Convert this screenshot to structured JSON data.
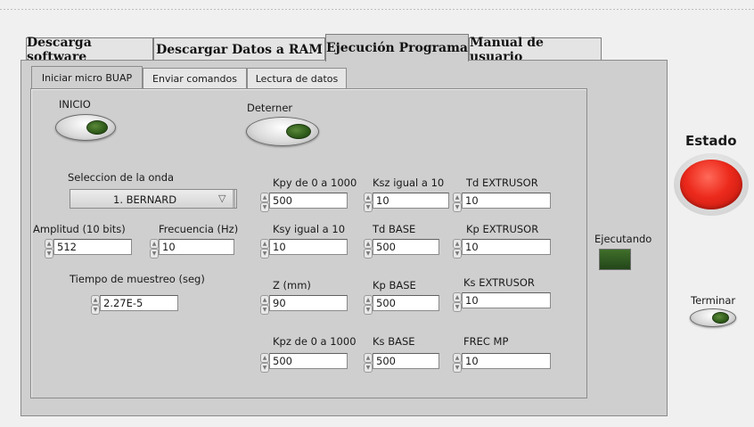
{
  "outer_tabs": [
    {
      "label": "Descarga software"
    },
    {
      "label": "Descargar Datos a RAM"
    },
    {
      "label": "Ejecución Programa"
    },
    {
      "label": "Manual de usuario"
    }
  ],
  "inner_tabs": [
    {
      "label": "Iniciar micro BUAP"
    },
    {
      "label": "Enviar comandos"
    },
    {
      "label": "Lectura de datos"
    }
  ],
  "buttons": {
    "inicio": "INICIO",
    "detener": "Deterner",
    "terminar": "Terminar"
  },
  "wave": {
    "label": "Seleccion de la onda",
    "selected": "1. BERNARD"
  },
  "amplitud": {
    "label": "Amplitud (10 bits)",
    "value": "512"
  },
  "frecuencia": {
    "label": "Frecuencia (Hz)",
    "value": "10"
  },
  "tiempo": {
    "label": "Tiempo de muestreo (seg)",
    "value": "2.27E-5"
  },
  "params": {
    "kpy": {
      "label": "Kpy de 0 a 1000",
      "value": "500"
    },
    "ksz": {
      "label": "Ksz igual a 10",
      "value": "10"
    },
    "td_extrusor": {
      "label": "Td EXTRUSOR",
      "value": "10"
    },
    "ksy": {
      "label": "Ksy igual a 10",
      "value": "10"
    },
    "td_base": {
      "label": "Td BASE",
      "value": "500"
    },
    "kp_extrusor": {
      "label": "Kp EXTRUSOR",
      "value": "10"
    },
    "z": {
      "label": "Z (mm)",
      "value": "90"
    },
    "kp_base": {
      "label": "Kp BASE",
      "value": "500"
    },
    "ks_extrusor": {
      "label": "Ks EXTRUSOR",
      "value": "10"
    },
    "kpz": {
      "label": "Kpz de 0 a 1000",
      "value": "500"
    },
    "ks_base": {
      "label": "Ks BASE",
      "value": "500"
    },
    "frec_mp": {
      "label": "FREC MP",
      "value": "10"
    }
  },
  "ejecutando": {
    "label": "Ejecutando",
    "color": "#2e5a1e"
  },
  "estado": {
    "label": "Estado",
    "color": "#e8251b"
  }
}
